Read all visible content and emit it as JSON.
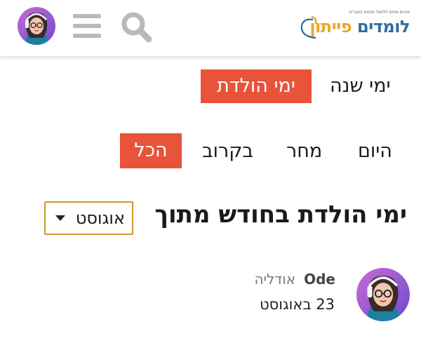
{
  "header": {
    "logo": {
      "tagline": "פורום ומיזם ללימוד תכנות בעברית",
      "text_main": "לומדים ",
      "text_accent": "פייתון"
    },
    "menu_icon": "hamburger-menu-icon",
    "search_icon": "search-icon",
    "avatar_icon": "user-avatar"
  },
  "tabs": {
    "year_days": "ימי שנה",
    "birthdays": "ימי הולדת"
  },
  "filters": {
    "today": "היום",
    "tomorrow": "מחר",
    "soon": "בקרוב",
    "all": "הכל"
  },
  "section": {
    "title": "ימי הולדת בחודש מתוך",
    "month_selected": "אוגוסט"
  },
  "entries": [
    {
      "username": "Ode",
      "full_name": "אודליה",
      "date": "23 באוגוסט"
    }
  ],
  "colors": {
    "accent": "#e8533a",
    "select_border": "#c99a2e",
    "logo_blue": "#2d6da3",
    "logo_yellow": "#e9a72b"
  }
}
